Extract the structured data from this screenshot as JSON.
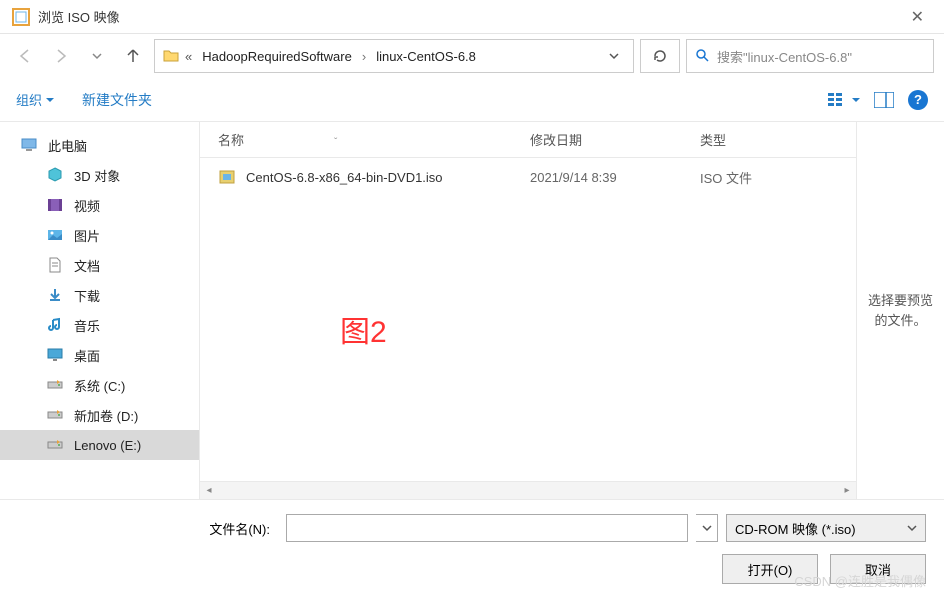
{
  "window": {
    "title": "浏览 ISO 映像",
    "close": "✕"
  },
  "nav": {
    "breadcrumb": {
      "overflow": "«",
      "seg1": "HadoopRequiredSoftware",
      "seg2": "linux-CentOS-6.8"
    },
    "search_placeholder": "搜索\"linux-CentOS-6.8\""
  },
  "toolbar": {
    "organize": "组织",
    "new_folder": "新建文件夹",
    "help": "?"
  },
  "sidebar": {
    "this_pc": "此电脑",
    "objects_3d": "3D 对象",
    "videos": "视频",
    "pictures": "图片",
    "documents": "文档",
    "downloads": "下载",
    "music": "音乐",
    "desktop": "桌面",
    "drive_c": "系统 (C:)",
    "drive_d": "新加卷 (D:)",
    "drive_e": "Lenovo (E:)"
  },
  "columns": {
    "name": "名称",
    "date": "修改日期",
    "type": "类型"
  },
  "files": [
    {
      "name": "CentOS-6.8-x86_64-bin-DVD1.iso",
      "date": "2021/9/14 8:39",
      "type": "ISO 文件"
    }
  ],
  "overlay": "图2",
  "preview": "选择要预览的文件。",
  "footer": {
    "filename_label": "文件名(N):",
    "filter": "CD-ROM 映像 (*.iso)",
    "open": "打开(O)",
    "cancel": "取消"
  },
  "watermark": "CSDN @连胜是我偶像"
}
